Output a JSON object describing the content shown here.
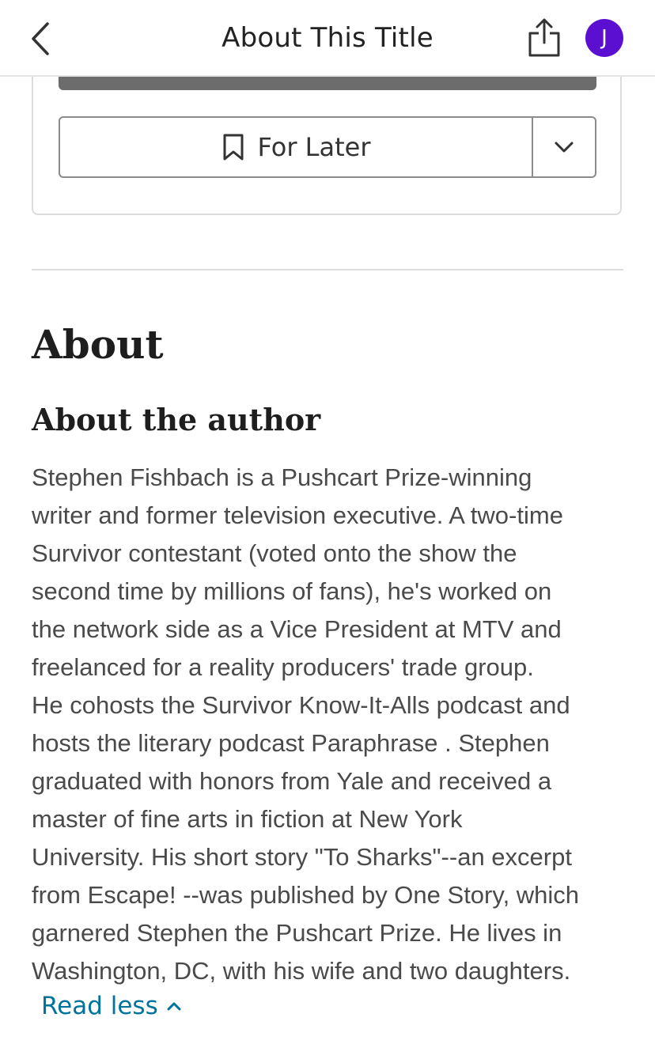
{
  "header": {
    "title": "About This Title",
    "avatar_initial": "J",
    "icons": {
      "back": "chevron-left-icon",
      "share": "share-icon"
    }
  },
  "actions": {
    "for_later_label": "For Later",
    "bookmark_icon": "bookmark-icon",
    "dropdown_icon": "chevron-down-icon"
  },
  "about": {
    "heading": "About",
    "author_heading": "About the author",
    "bio_lines": [
      "Stephen Fishbach is a Pushcart Prize-winning",
      "writer and former television executive. A two-time",
      "Survivor contestant (voted onto the show the",
      "second time by millions of fans), he's worked on",
      "the network side as a Vice President at MTV and",
      "freelanced for a reality producers' trade group.",
      "He cohosts the Survivor Know-It-Alls podcast and",
      "hosts the literary podcast Paraphrase . Stephen",
      "graduated with honors from Yale and received a",
      "master of fine arts in fiction at New York",
      "University. His short story \"To Sharks\"--an excerpt",
      "from Escape! --was published by One Story, which",
      "garnered Stephen the Pushcart Prize. He lives in",
      "Washington, DC, with his wife and two daughters."
    ],
    "read_less_label": "Read less"
  },
  "colors": {
    "avatar_bg": "#5b0fd1",
    "link": "#00739c",
    "primary_bar": "#6c6c6c",
    "border": "#dcdcdc"
  }
}
